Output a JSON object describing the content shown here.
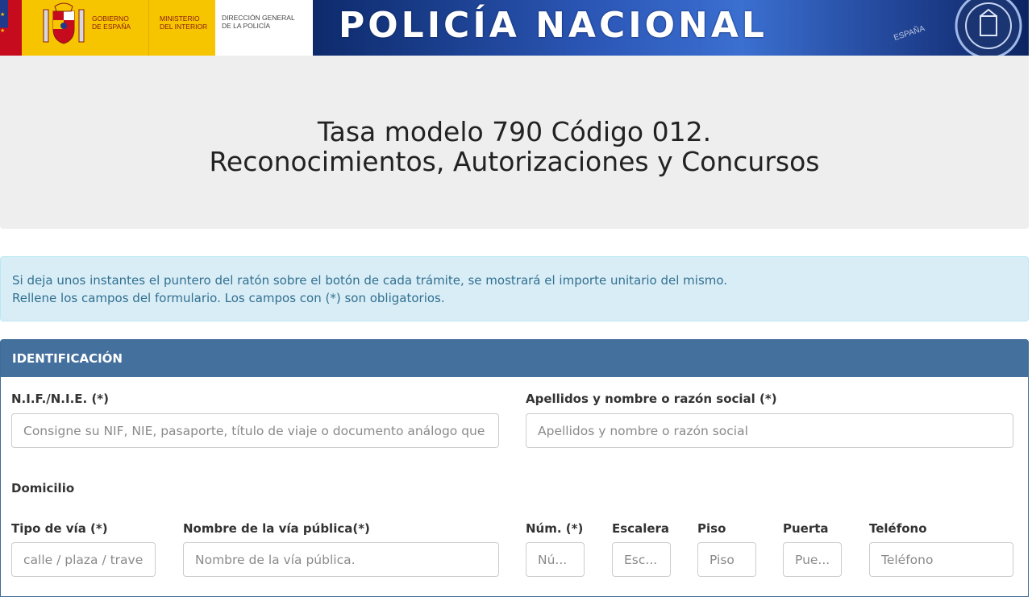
{
  "header": {
    "gov_line1": "Gobierno",
    "gov_line2": "de España",
    "min_line1": "Ministerio",
    "min_line2": "del Interior",
    "dg_line1": "Dirección General",
    "dg_line2": "de la Policía",
    "police_title": "POLICÍA NACIONAL",
    "badge_label": "ESPAÑA"
  },
  "page": {
    "title_line1": "Tasa modelo 790 Código 012.",
    "title_line2": "Reconocimientos, Autorizaciones y Concursos"
  },
  "alert": {
    "line1": "Si deja unos instantes el puntero del ratón sobre el botón de cada trámite, se mostrará el importe unitario del mismo.",
    "line2": "Rellene los campos del formulario. Los campos con (*) son obligatorios."
  },
  "identificacion": {
    "heading": "IDENTIFICACIÓN",
    "nif_label": "N.I.F./N.I.E. (*)",
    "nif_placeholder": "Consigne su NIF, NIE, pasaporte, título de viaje o documento análogo que acr...",
    "nombre_label": "Apellidos y nombre o razón social (*)",
    "nombre_placeholder": "Apellidos y nombre o razón social",
    "domicilio_label": "Domicilio",
    "tipo_via_label": "Tipo de vía (*)",
    "tipo_via_placeholder": "calle / plaza / trave...",
    "via_label": "Nombre de la vía pública(*)",
    "via_placeholder": "Nombre de la vía pública.",
    "num_label": "Núm. (*)",
    "num_placeholder": "Nú...",
    "escalera_label": "Escalera",
    "escalera_placeholder": "Esc...",
    "piso_label": "Piso",
    "piso_placeholder": "Piso",
    "puerta_label": "Puerta",
    "puerta_placeholder": "Pue...",
    "telefono_label": "Teléfono",
    "telefono_placeholder": "Teléfono"
  },
  "colors": {
    "alert_bg": "#d9edf7",
    "alert_text": "#31708f",
    "panel_heading": "#44709d",
    "title_bg": "#eeeeee"
  }
}
